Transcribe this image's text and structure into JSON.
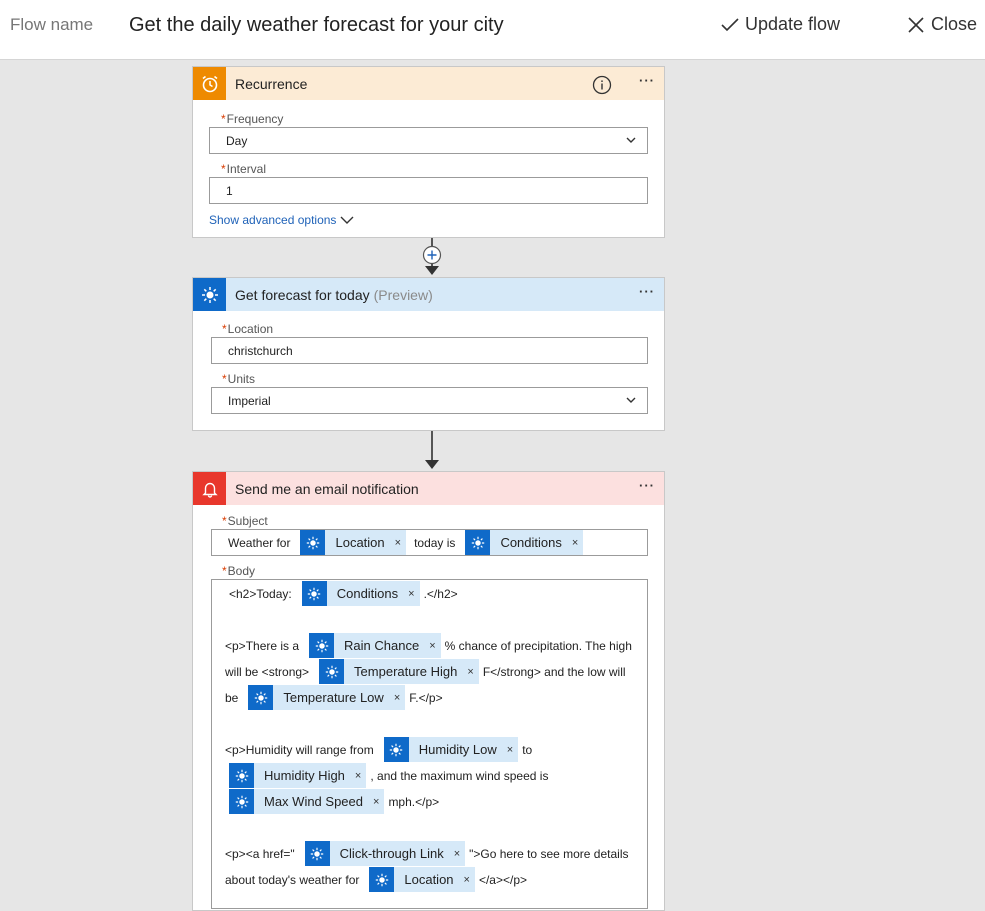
{
  "header": {
    "flow_name_label": "Flow name",
    "flow_title": "Get the daily weather forecast for your city",
    "update_label": "Update flow",
    "close_label": "Close"
  },
  "recurrence": {
    "title": "Recurrence",
    "menu": "···",
    "frequency_label": "Frequency",
    "frequency_value": "Day",
    "interval_label": "Interval",
    "interval_value": "1",
    "advanced_link": "Show advanced options",
    "accent": "#ee8a00",
    "header_bg": "#fcebd5"
  },
  "forecast": {
    "title": "Get forecast for today",
    "preview": "(Preview)",
    "menu": "···",
    "location_label": "Location",
    "location_value": "christchurch",
    "units_label": "Units",
    "units_value": "Imperial",
    "accent": "#0f6ac9",
    "header_bg": "#d6e9f8"
  },
  "email": {
    "title": "Send me an email notification",
    "menu": "···",
    "subject_label": "Subject",
    "subject": {
      "text1": "Weather for",
      "token1": "Location",
      "text2": "today is",
      "token2": "Conditions"
    },
    "body_label": "Body",
    "body": {
      "l1_a": "<h2>Today:",
      "l1_token": "Conditions",
      "l1_b": ".</h2>",
      "l2_a": "<p>There is a",
      "l2_token": "Rain Chance",
      "l2_b": "% chance of precipitation. The high",
      "l3_a": "will be <strong>",
      "l3_token": "Temperature High",
      "l3_b": "F</strong> and the low will",
      "l4_a": "be",
      "l4_token": "Temperature Low",
      "l4_b": "F.</p>",
      "l5_a": "<p>Humidity will range from",
      "l5_token": "Humidity Low",
      "l5_b": "to",
      "l6_token": "Humidity High",
      "l6_b": ", and the maximum wind speed is",
      "l7_token": "Max Wind Speed",
      "l7_b": "mph.</p>",
      "l8_a": "<p><a href=\"",
      "l8_token": "Click-through Link",
      "l8_b": "\">Go here to see more details",
      "l9_a": "about today's weather for",
      "l9_token": "Location",
      "l9_b": "</a></p>"
    },
    "accent": "#e8372c",
    "header_bg": "#fce0df"
  },
  "token_close": "×",
  "icons": [
    "check-icon",
    "close-x-icon",
    "alarm-clock-icon",
    "info-icon",
    "sun-icon",
    "bell-icon",
    "chevron-down-icon",
    "plus-circle-icon",
    "arrow-down-icon"
  ]
}
